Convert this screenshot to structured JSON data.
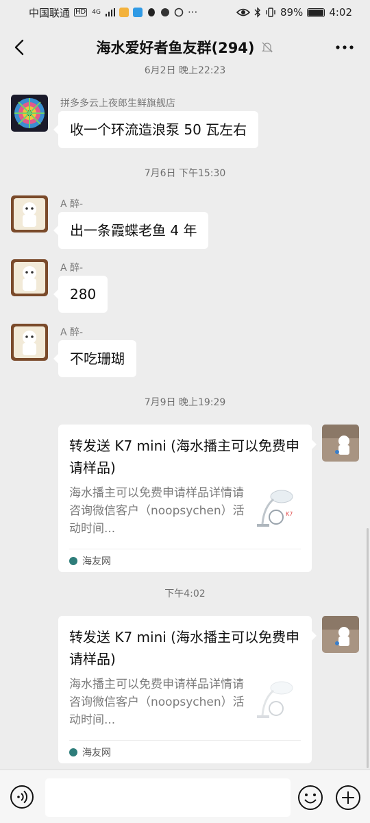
{
  "status_bar": {
    "carrier": "中国联通",
    "hd_badge": "HD",
    "network": "4G",
    "battery_percent": "89%",
    "battery_level": 0.89,
    "time": "4:02",
    "more": "···"
  },
  "header": {
    "title": "海水爱好者鱼友群(294)",
    "back_icon": "chevron-left-icon",
    "mute_icon": "bell-muted-icon",
    "more_icon": "more-dots-icon"
  },
  "chat": {
    "timestamps": [
      "6月2日 晚上22:23",
      "7月6日 下午15:30",
      "7月9日 晚上19:29",
      "下午4:02"
    ],
    "messages": [
      {
        "sender": "拼多多云上夜郎生鲜旗舰店",
        "text": "收一个环流造浪泵 50 瓦左右"
      },
      {
        "sender": "A 醉-",
        "text": "出一条霞蝶老鱼 4 年"
      },
      {
        "sender": "A 醉-",
        "text": "280"
      },
      {
        "sender": "A 醉-",
        "text": "不吃珊瑚"
      }
    ],
    "cards": [
      {
        "title": "转发送 K7 mini (海水播主可以免费申请样品)",
        "description": "海水播主可以免费申请样品详情请咨询微信客户（noopsychen）活动时间...",
        "source": "海友网"
      },
      {
        "title": "转发送 K7 mini (海水播主可以免费申请样品)",
        "description": "海水播主可以免费申请样品详情请咨询微信客户（noopsychen）活动时间...",
        "source": "海友网"
      }
    ]
  },
  "input_bar": {
    "placeholder": "",
    "voice_icon": "voice-icon",
    "emoji_icon": "emoji-icon",
    "plus_icon": "plus-icon"
  },
  "colors": {
    "background": "#ededed",
    "bubble": "#ffffff",
    "timestamp_text": "#6e6e6e",
    "sender_text": "#7a7a7a"
  }
}
